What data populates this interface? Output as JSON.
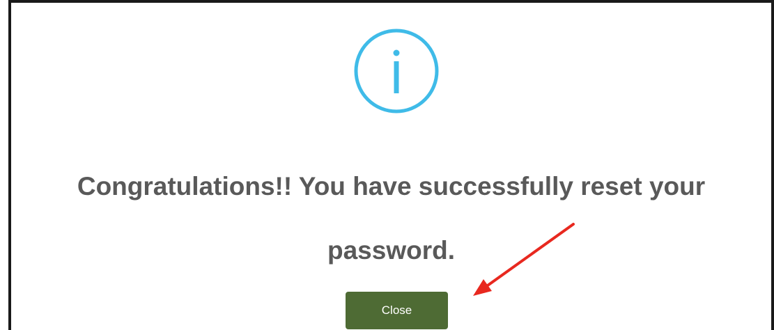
{
  "dialog": {
    "icon": "info-icon",
    "message_line1": "Congratulations!! You have successfully reset your",
    "message_line2": "password.",
    "close_label": "Close"
  },
  "colors": {
    "icon": "#3fbbe8",
    "message_text": "#595959",
    "button_bg": "#4e6b34",
    "button_text": "#ffffff",
    "annotation_arrow": "#e8281f"
  },
  "annotation": {
    "icon": "red-arrow-icon",
    "points_to": "close-button"
  }
}
